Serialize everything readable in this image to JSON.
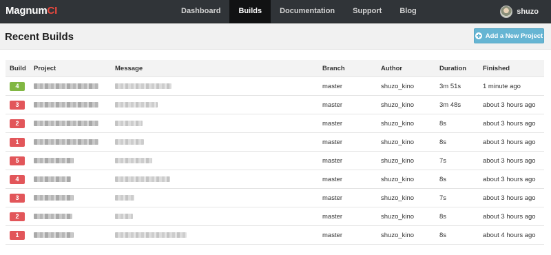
{
  "navbar": {
    "brand_main": "Magnum",
    "brand_accent": "CI",
    "items": [
      {
        "label": "Dashboard",
        "active": false
      },
      {
        "label": "Builds",
        "active": true
      },
      {
        "label": "Documentation",
        "active": false
      },
      {
        "label": "Support",
        "active": false
      },
      {
        "label": "Blog",
        "active": false
      }
    ],
    "user_name": "shuzo"
  },
  "page": {
    "title": "Recent Builds",
    "add_button_label": "Add a New Project"
  },
  "table": {
    "columns": [
      "Build",
      "Project",
      "Message",
      "Branch",
      "Author",
      "Duration",
      "Finished"
    ],
    "rows": [
      {
        "build": "4",
        "status": "pass",
        "branch": "master",
        "author": "shuzo_kino",
        "duration": "3m 51s",
        "finished": "1 minute ago"
      },
      {
        "build": "3",
        "status": "fail",
        "branch": "master",
        "author": "shuzo_kino",
        "duration": "3m 48s",
        "finished": "about 3 hours ago"
      },
      {
        "build": "2",
        "status": "fail",
        "branch": "master",
        "author": "shuzo_kino",
        "duration": "8s",
        "finished": "about 3 hours ago"
      },
      {
        "build": "1",
        "status": "fail",
        "branch": "master",
        "author": "shuzo_kino",
        "duration": "8s",
        "finished": "about 3 hours ago"
      },
      {
        "build": "5",
        "status": "fail",
        "branch": "master",
        "author": "shuzo_kino",
        "duration": "7s",
        "finished": "about 3 hours ago"
      },
      {
        "build": "4",
        "status": "fail",
        "branch": "master",
        "author": "shuzo_kino",
        "duration": "8s",
        "finished": "about 3 hours ago"
      },
      {
        "build": "3",
        "status": "fail",
        "branch": "master",
        "author": "shuzo_kino",
        "duration": "7s",
        "finished": "about 3 hours ago"
      },
      {
        "build": "2",
        "status": "fail",
        "branch": "master",
        "author": "shuzo_kino",
        "duration": "8s",
        "finished": "about 3 hours ago"
      },
      {
        "build": "1",
        "status": "fail",
        "branch": "master",
        "author": "shuzo_kino",
        "duration": "8s",
        "finished": "about 4 hours ago"
      }
    ]
  },
  "colors": {
    "navbar_bg": "#303438",
    "brand_accent": "#e8483e",
    "badge_pass": "#81b743",
    "badge_fail": "#e2565a",
    "add_button_bg": "#66b5d3"
  }
}
